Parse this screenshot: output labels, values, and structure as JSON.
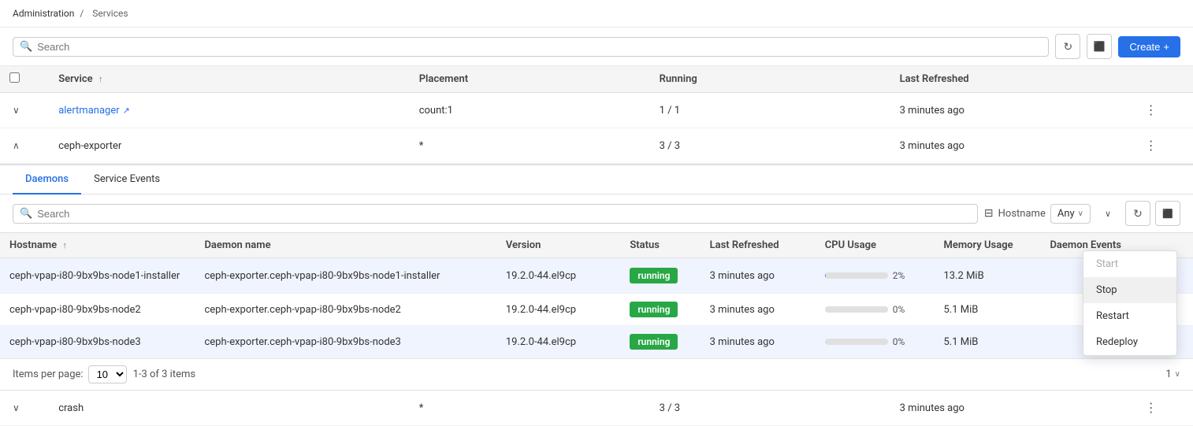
{
  "breadcrumb": {
    "parent": "Administration",
    "separator": "/",
    "current": "Services"
  },
  "toolbar": {
    "search_placeholder": "Search",
    "refresh_icon": "↻",
    "download_icon": "⬇",
    "create_label": "Create",
    "create_icon": "+"
  },
  "services_table": {
    "columns": [
      {
        "key": "service",
        "label": "Service",
        "sortable": true
      },
      {
        "key": "placement",
        "label": "Placement"
      },
      {
        "key": "running",
        "label": "Running"
      },
      {
        "key": "last_refreshed",
        "label": "Last Refreshed"
      }
    ],
    "rows": [
      {
        "id": "alertmanager",
        "expanded": true,
        "service": "alertmanager",
        "service_link": true,
        "placement": "count:1",
        "running": "1 / 1",
        "last_refreshed": "3 minutes ago"
      },
      {
        "id": "ceph-exporter",
        "expanded": true,
        "service": "ceph-exporter",
        "service_link": false,
        "placement": "*",
        "running": "3 / 3",
        "last_refreshed": "3 minutes ago"
      },
      {
        "id": "crash",
        "expanded": false,
        "service": "crash",
        "service_link": false,
        "placement": "*",
        "running": "3 / 3",
        "last_refreshed": "3 minutes ago"
      }
    ]
  },
  "daemons_section": {
    "tabs": [
      {
        "id": "daemons",
        "label": "Daemons",
        "active": true
      },
      {
        "id": "service-events",
        "label": "Service Events",
        "active": false
      }
    ],
    "toolbar": {
      "search_placeholder": "Search",
      "filter_icon": "⊟",
      "filter_label": "Hostname",
      "filter_value": "Any",
      "refresh_icon": "↻",
      "download_icon": "⬇"
    },
    "columns": [
      {
        "key": "hostname",
        "label": "Hostname",
        "sortable": true
      },
      {
        "key": "daemon_name",
        "label": "Daemon name"
      },
      {
        "key": "version",
        "label": "Version"
      },
      {
        "key": "status",
        "label": "Status"
      },
      {
        "key": "last_refreshed",
        "label": "Last Refreshed"
      },
      {
        "key": "cpu_usage",
        "label": "CPU Usage"
      },
      {
        "key": "memory_usage",
        "label": "Memory Usage"
      },
      {
        "key": "daemon_events",
        "label": "Daemon Events"
      }
    ],
    "rows": [
      {
        "hostname": "ceph-vpap-i80-9bx9bs-node1-installer",
        "daemon_name": "ceph-exporter.ceph-vpap-i80-9bx9bs-node1-installer",
        "version": "19.2.0-44.el9cp",
        "status": "running",
        "last_refreshed": "3 minutes ago",
        "cpu_pct": 2,
        "cpu_pct_label": "2%",
        "cpu_color": "blue",
        "memory_usage": "13.2 MiB",
        "daemon_events": "",
        "selected": true
      },
      {
        "hostname": "ceph-vpap-i80-9bx9bs-node2",
        "daemon_name": "ceph-exporter.ceph-vpap-i80-9bx9bs-node2",
        "version": "19.2.0-44.el9cp",
        "status": "running",
        "last_refreshed": "3 minutes ago",
        "cpu_pct": 0,
        "cpu_pct_label": "0%",
        "cpu_color": "gray",
        "memory_usage": "5.1 MiB",
        "daemon_events": ""
      },
      {
        "hostname": "ceph-vpap-i80-9bx9bs-node3",
        "daemon_name": "ceph-exporter.ceph-vpap-i80-9bx9bs-node3",
        "version": "19.2.0-44.el9cp",
        "status": "running",
        "last_refreshed": "3 minutes ago",
        "cpu_pct": 0,
        "cpu_pct_label": "0%",
        "cpu_color": "gray",
        "memory_usage": "5.1 MiB",
        "daemon_events": ""
      }
    ],
    "pagination": {
      "items_per_page_label": "Items per page:",
      "items_per_page_value": "10",
      "range_label": "1-3 of 3 items",
      "page": "1"
    }
  },
  "context_menu": {
    "items": [
      {
        "label": "Start",
        "disabled": true,
        "id": "start"
      },
      {
        "label": "Stop",
        "disabled": false,
        "id": "stop",
        "hovered": true
      },
      {
        "label": "Restart",
        "disabled": false,
        "id": "restart"
      },
      {
        "label": "Redeploy",
        "disabled": false,
        "id": "redeploy"
      }
    ]
  },
  "colors": {
    "accent": "#2670e8",
    "running_bg": "#28a745",
    "running_text": "#fff"
  }
}
